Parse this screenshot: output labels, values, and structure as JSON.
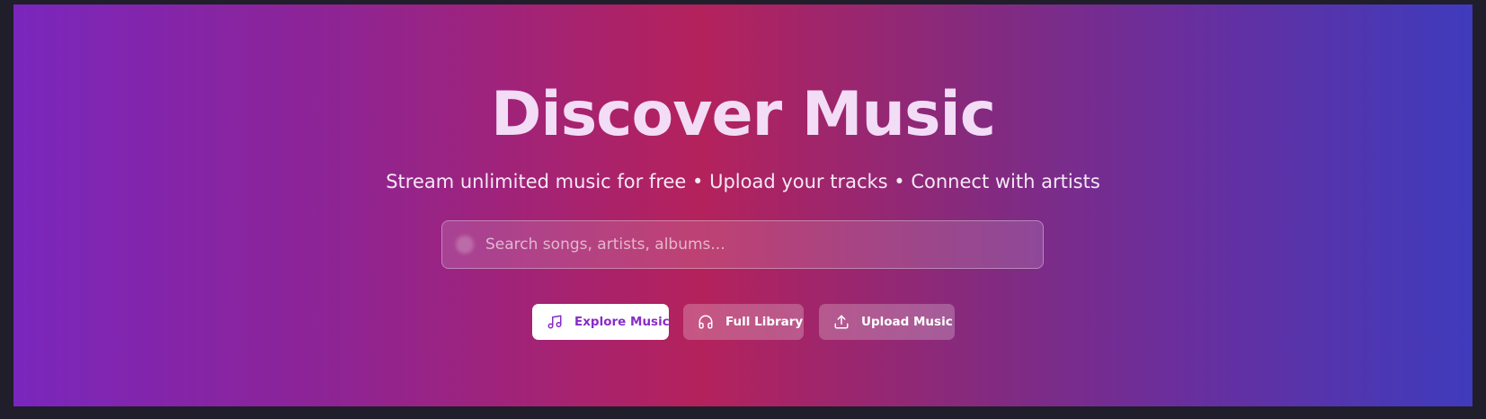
{
  "hero": {
    "title": "Discover Music",
    "subtitle": "Stream unlimited music for free • Upload your tracks • Connect with artists"
  },
  "search": {
    "placeholder": "Search songs, artists, albums...",
    "value": ""
  },
  "actions": {
    "explore_label": "Explore Music",
    "library_label": "Full Library",
    "upload_label": "Upload Music"
  },
  "icons": {
    "search": "search-icon",
    "explore": "music-note-icon",
    "library": "headphones-icon",
    "upload": "upload-icon"
  },
  "colors": {
    "page_background": "#1f1e2a",
    "gradient_left": "#7a26bd",
    "gradient_center": "#b4225c",
    "gradient_right": "#3f3bbc",
    "primary_button_text": "#8a2bc8"
  }
}
